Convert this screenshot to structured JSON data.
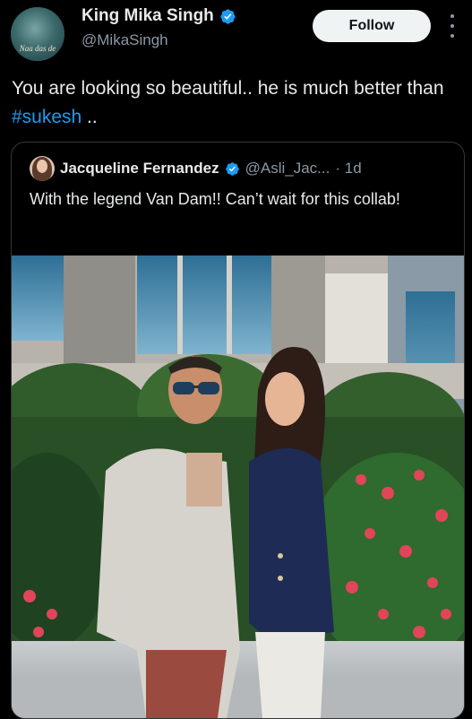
{
  "tweet": {
    "author_name": "King Mika Singh",
    "author_handle": "@MikaSingh",
    "avatar_text": "Naa das de",
    "follow_label": "Follow",
    "text_before": "You are looking so beautiful.. he is much better than ",
    "hashtag": "#sukesh",
    "text_after": " .."
  },
  "quoted": {
    "author_name": "Jacqueline Fernandez",
    "author_handle": "@Asli_Jac...",
    "time": "· 1d",
    "text": "With the legend Van Dam!! Can’t wait for this collab!"
  },
  "colors": {
    "background": "#000000",
    "text": "#e7e9ea",
    "secondary": "#8b98a5",
    "accent": "#1d9bf0",
    "follow_bg": "#eff3f4"
  },
  "icons": [
    "verified-badge-icon",
    "more-options-icon"
  ]
}
